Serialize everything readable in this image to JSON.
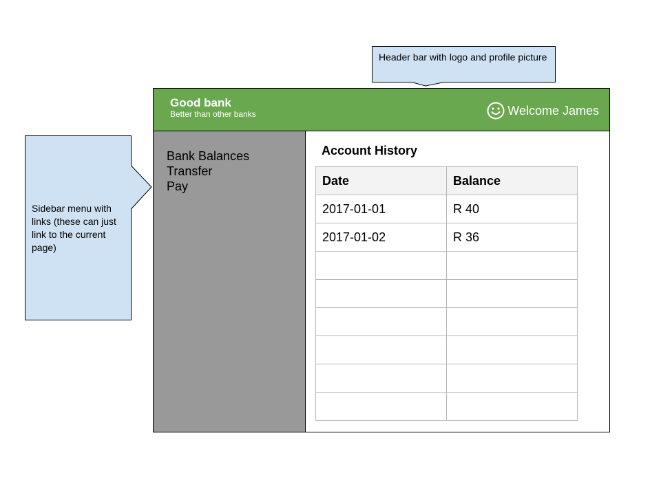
{
  "annotations": {
    "header_note": "Header bar with logo and profile picture",
    "sidebar_note": "Sidebar menu with links (these can just link to the current page)"
  },
  "header": {
    "brand_name": "Good bank",
    "tagline": "Better than other banks",
    "welcome": "Welcome James",
    "avatar_icon": "smiley-icon",
    "background_color": "#6aa84f"
  },
  "sidebar": {
    "background_color": "#999999",
    "items": [
      {
        "label": "Bank Balances"
      },
      {
        "label": "Transfer"
      },
      {
        "label": "Pay"
      }
    ]
  },
  "main": {
    "title": "Account History",
    "table": {
      "headers": [
        "Date",
        "Balance"
      ],
      "rows": [
        [
          "2017-01-01",
          "R 40"
        ],
        [
          "2017-01-02",
          "R 36"
        ],
        [
          "",
          ""
        ],
        [
          "",
          ""
        ],
        [
          "",
          ""
        ],
        [
          "",
          ""
        ],
        [
          "",
          ""
        ],
        [
          "",
          ""
        ]
      ]
    }
  },
  "colors": {
    "callout_fill": "#cfe2f3",
    "table_border": "#b7b7b7",
    "table_header_fill": "#f3f3f3"
  }
}
